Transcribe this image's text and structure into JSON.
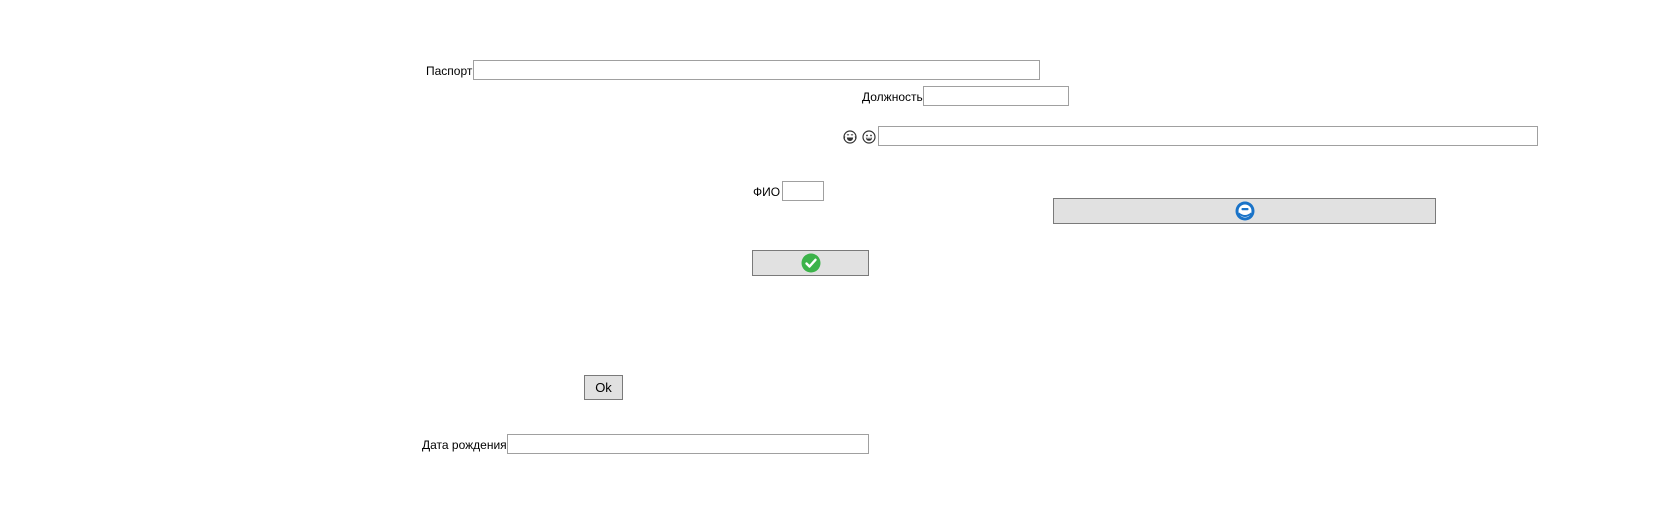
{
  "form": {
    "passport_label": "Паспорт",
    "passport_value": "",
    "position_label": "Должность",
    "position_value": "",
    "emoji_field_value": "",
    "fio_label": "ФИО",
    "fio_value": "",
    "ok_button_label": "Ok",
    "birthdate_label": "Дата рождения",
    "birthdate_value": ""
  },
  "icons": {
    "emoji_1": "laughing-face-icon",
    "emoji_2": "smiling-face-icon",
    "wide_button_icon": "blue-round-badge-icon",
    "confirm_button_icon": "green-checkmark-icon"
  },
  "colors": {
    "button_bg": "#e1e1e1",
    "field_border": "#a0a0a0",
    "check_green": "#3cb34a",
    "badge_blue": "#1a73c8"
  }
}
